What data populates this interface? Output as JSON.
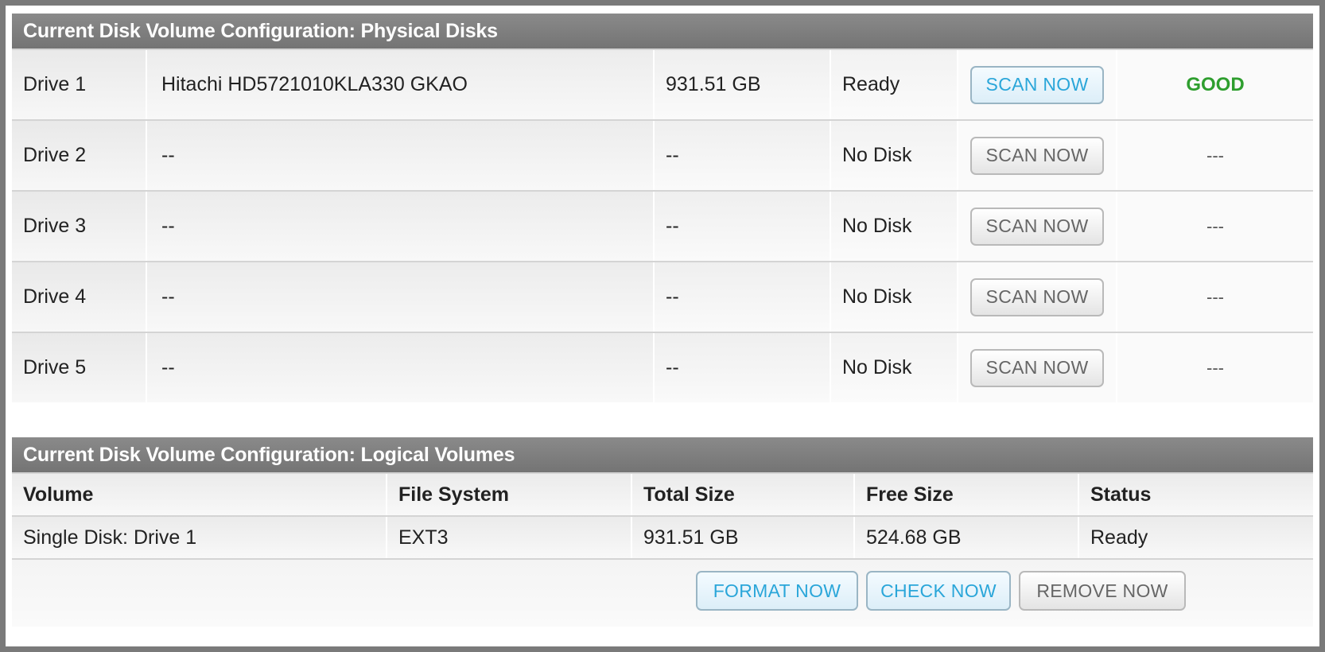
{
  "physical": {
    "header": "Current Disk Volume Configuration: Physical Disks",
    "drives": [
      {
        "name": "Drive 1",
        "model": "Hitachi HD5721010KLA330 GKAO",
        "size": "931.51 GB",
        "state": "Ready",
        "button": "SCAN NOW",
        "health": "GOOD"
      },
      {
        "name": "Drive 2",
        "model": "--",
        "size": "--",
        "state": "No Disk",
        "button": "SCAN NOW",
        "health": "---"
      },
      {
        "name": "Drive 3",
        "model": "--",
        "size": "--",
        "state": "No Disk",
        "button": "SCAN NOW",
        "health": "---"
      },
      {
        "name": "Drive 4",
        "model": "--",
        "size": "--",
        "state": "No Disk",
        "button": "SCAN NOW",
        "health": "---"
      },
      {
        "name": "Drive 5",
        "model": "--",
        "size": "--",
        "state": "No Disk",
        "button": "SCAN NOW",
        "health": "---"
      }
    ]
  },
  "logical": {
    "header": "Current Disk Volume Configuration: Logical Volumes",
    "columns": [
      "Volume",
      "File System",
      "Total Size",
      "Free Size",
      "Status"
    ],
    "rows": [
      {
        "volume": "Single Disk: Drive 1",
        "fs": "EXT3",
        "total": "931.51 GB",
        "free": "524.68 GB",
        "status": "Ready"
      }
    ],
    "actions": {
      "format": "FORMAT NOW",
      "check": "CHECK NOW",
      "remove": "REMOVE NOW"
    }
  },
  "colors": {
    "header_bg": "#7c7c7c",
    "good": "#2e9e2e",
    "active_button_text": "#2aa6d9"
  }
}
